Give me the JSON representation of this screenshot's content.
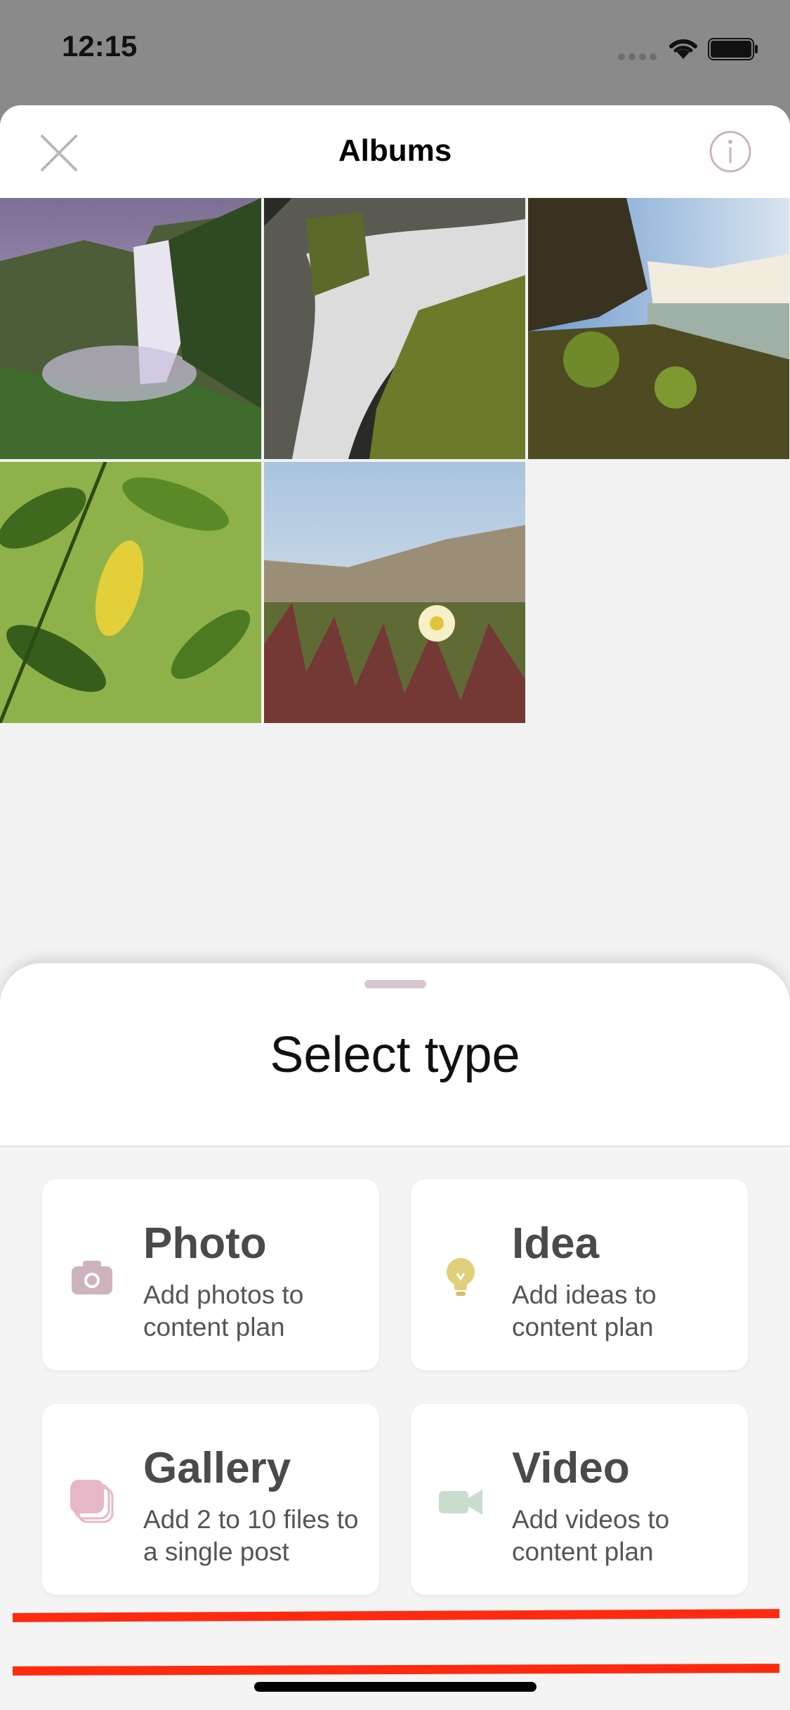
{
  "status_bar": {
    "time": "12:15"
  },
  "nav": {
    "title": "Albums",
    "close_icon": "close-icon",
    "info_icon": "info-icon"
  },
  "photos": [
    {
      "name": "waterfall-mist"
    },
    {
      "name": "waterfall-rocks"
    },
    {
      "name": "river-falls"
    },
    {
      "name": "leaves"
    },
    {
      "name": "beach-flower"
    }
  ],
  "select_panel": {
    "title": "Select type",
    "options": [
      {
        "title": "Photo",
        "description": "Add photos to content plan",
        "icon": "camera-icon",
        "color": "#cdb3be"
      },
      {
        "title": "Idea",
        "description": "Add ideas to content plan",
        "icon": "lightbulb-icon",
        "color": "#e0cf7a"
      },
      {
        "title": "Gallery",
        "description": "Add 2 to 10 files to a single post",
        "icon": "stack-icon",
        "color": "#e6b7c7"
      },
      {
        "title": "Video",
        "description": "Add videos to content plan",
        "icon": "video-camera-icon",
        "color": "#c9dccd"
      }
    ]
  },
  "colors": {
    "accent_red": "#ff2a10",
    "panel_bg": "#f4f4f4",
    "card_bg": "#ffffff"
  }
}
